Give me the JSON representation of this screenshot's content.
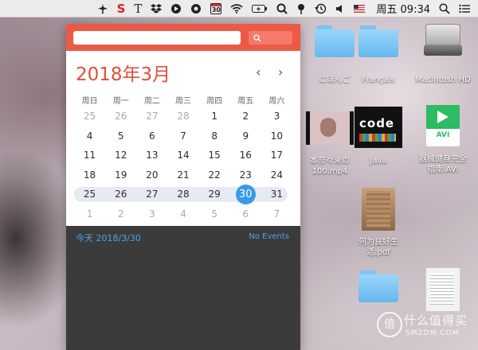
{
  "menubar": {
    "icons": [
      "airplane-icon",
      "scrivener-s-icon",
      "type-t-icon",
      "dropbox-icon",
      "circle-icon",
      "bear-icon",
      "calendar-icon",
      "wifi-icon",
      "battery-icon",
      "search-magnifier-icon",
      "pin-icon",
      "time-machine-icon",
      "volume-icon",
      "flag-icon",
      "spotlight-icon",
      "notification-center-icon"
    ],
    "calendar_badge": "30",
    "clock": "周五 09:34"
  },
  "calendar": {
    "title": "2018年3月",
    "prev": "‹",
    "next": "›",
    "weekdays": [
      "周日",
      "周一",
      "周二",
      "周三",
      "周四",
      "周五",
      "周六"
    ],
    "weeks": [
      [
        {
          "d": "25",
          "dim": true
        },
        {
          "d": "26",
          "dim": true
        },
        {
          "d": "27",
          "dim": true
        },
        {
          "d": "28",
          "dim": true
        },
        {
          "d": "1"
        },
        {
          "d": "2"
        },
        {
          "d": "3"
        }
      ],
      [
        {
          "d": "4"
        },
        {
          "d": "5"
        },
        {
          "d": "6"
        },
        {
          "d": "7"
        },
        {
          "d": "8"
        },
        {
          "d": "9"
        },
        {
          "d": "10"
        }
      ],
      [
        {
          "d": "11"
        },
        {
          "d": "12"
        },
        {
          "d": "13"
        },
        {
          "d": "14"
        },
        {
          "d": "15"
        },
        {
          "d": "16"
        },
        {
          "d": "17"
        }
      ],
      [
        {
          "d": "18"
        },
        {
          "d": "19"
        },
        {
          "d": "20"
        },
        {
          "d": "21"
        },
        {
          "d": "22"
        },
        {
          "d": "23"
        },
        {
          "d": "24"
        }
      ],
      [
        {
          "d": "25"
        },
        {
          "d": "26"
        },
        {
          "d": "27"
        },
        {
          "d": "28"
        },
        {
          "d": "29"
        },
        {
          "d": "30",
          "today": true
        },
        {
          "d": "31"
        }
      ],
      [
        {
          "d": "1",
          "dim": true
        },
        {
          "d": "2",
          "dim": true
        },
        {
          "d": "3",
          "dim": true
        },
        {
          "d": "4",
          "dim": true
        },
        {
          "d": "5",
          "dim": true
        },
        {
          "d": "6",
          "dim": true
        },
        {
          "d": "7",
          "dim": true
        }
      ]
    ],
    "highlight_week": 4,
    "events_date": "今天 2018/3/30",
    "events_status": "No Events",
    "colors": {
      "header": "#ec5a47",
      "title": "#e04e3a",
      "today": "#3a98ea",
      "events_bg": "#3b3b3b"
    }
  },
  "desktop": {
    "icons": [
      {
        "name": "folder-nihongo",
        "label": "にほんご"
      },
      {
        "name": "folder-francais",
        "label": "Français"
      },
      {
        "name": "macintosh-hd",
        "label": "Macintosh HD"
      },
      {
        "name": "video-file",
        "label": "本奈々未の\n100.mp4"
      },
      {
        "name": "java-folder",
        "label": "Java",
        "thumb_text": "code"
      },
      {
        "name": "avi-file",
        "label": "器械健身完全\n指南.AVI",
        "ext": "AVI"
      },
      {
        "name": "pdf-file",
        "label": "何为良好生\n活.pdf"
      },
      {
        "name": "folder-bottom",
        "label": ""
      },
      {
        "name": "document-bottom",
        "label": ""
      }
    ]
  },
  "watermark": {
    "main": "什么值得买",
    "sub": "SMZDM.COM",
    "mark": "值"
  }
}
